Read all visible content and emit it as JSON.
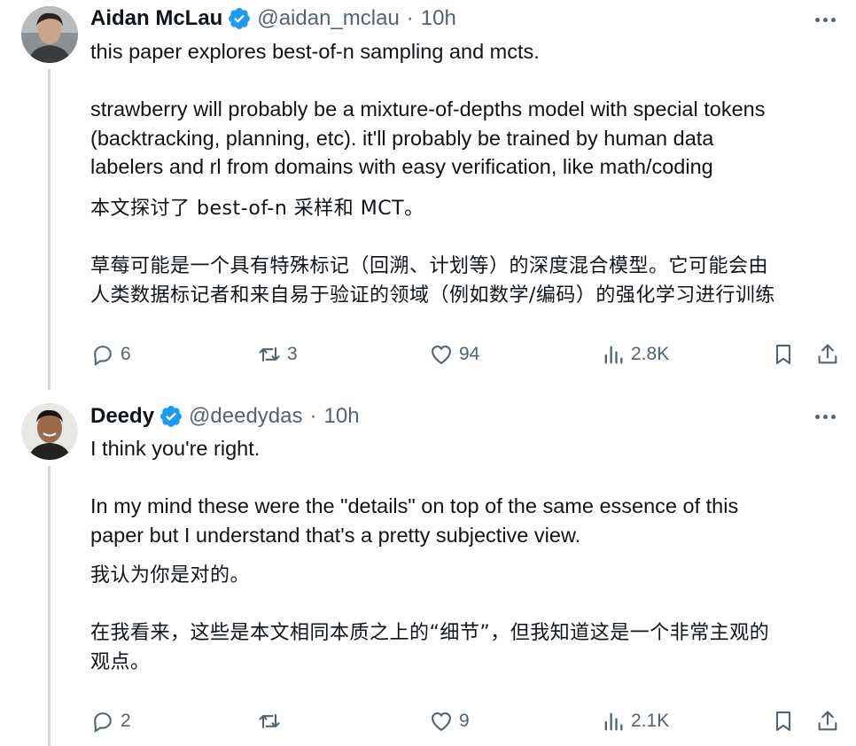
{
  "tweets": [
    {
      "author_name": "Aidan McLau",
      "handle": "@aidan_mclau",
      "separator": "·",
      "time": "10h",
      "lines": [
        "this paper explores best-of-n sampling and mcts.",
        "",
        "strawberry will probably be a mixture-of-depths model with special tokens",
        "(backtracking, planning, etc). it'll probably be trained by human data",
        "labelers and rl from domains with easy verification, like math/coding"
      ],
      "translation_lines": [
        "本文探讨了 best-of-n 采样和 MCT。",
        "",
        "草莓可能是一个具有特殊标记（回溯、计划等）的深度混合模型。它可能会由",
        "人类数据标记者和来自易于验证的领域（例如数学/编码）的强化学习进行训练"
      ],
      "stats": {
        "replies": "6",
        "reposts": "3",
        "likes": "94",
        "views": "2.8K"
      }
    },
    {
      "author_name": "Deedy",
      "handle": "@deedydas",
      "separator": "·",
      "time": "10h",
      "lines": [
        "I think you're right.",
        "",
        "In my mind these were the \"details\" on top of the same essence of this",
        "paper but I understand that's a pretty subjective view."
      ],
      "translation_lines": [
        "我认为你是对的。",
        "",
        "在我看来，这些是本文相同本质之上的“细节”，但我知道这是一个非常主观的",
        "观点。"
      ],
      "stats": {
        "replies": "2",
        "reposts": "",
        "likes": "9",
        "views": "2.1K"
      }
    }
  ],
  "colors": {
    "verified": "#1d9bf0",
    "secondary_text": "#536471",
    "primary_text": "#0f1419",
    "thread_line": "#cfd9de"
  },
  "icons": {
    "reply": "reply-icon",
    "repost": "repost-icon",
    "like": "heart-icon",
    "views": "views-icon",
    "bookmark": "bookmark-icon",
    "share": "share-icon",
    "more": "more-icon",
    "verified": "verified-badge-icon"
  }
}
